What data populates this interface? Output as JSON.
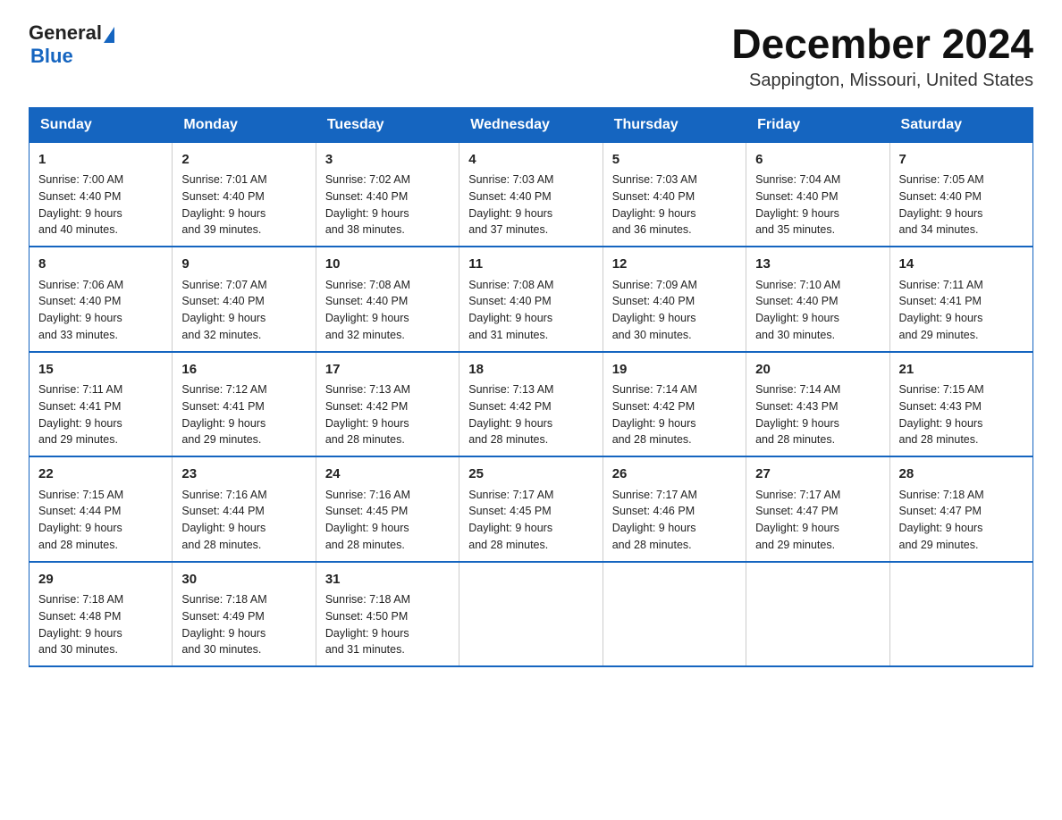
{
  "header": {
    "logo_general": "General",
    "logo_blue": "Blue",
    "month_title": "December 2024",
    "location": "Sappington, Missouri, United States"
  },
  "days_of_week": [
    "Sunday",
    "Monday",
    "Tuesday",
    "Wednesday",
    "Thursday",
    "Friday",
    "Saturday"
  ],
  "weeks": [
    [
      {
        "day": "1",
        "sunrise": "Sunrise: 7:00 AM",
        "sunset": "Sunset: 4:40 PM",
        "daylight": "Daylight: 9 hours",
        "minutes": "and 40 minutes."
      },
      {
        "day": "2",
        "sunrise": "Sunrise: 7:01 AM",
        "sunset": "Sunset: 4:40 PM",
        "daylight": "Daylight: 9 hours",
        "minutes": "and 39 minutes."
      },
      {
        "day": "3",
        "sunrise": "Sunrise: 7:02 AM",
        "sunset": "Sunset: 4:40 PM",
        "daylight": "Daylight: 9 hours",
        "minutes": "and 38 minutes."
      },
      {
        "day": "4",
        "sunrise": "Sunrise: 7:03 AM",
        "sunset": "Sunset: 4:40 PM",
        "daylight": "Daylight: 9 hours",
        "minutes": "and 37 minutes."
      },
      {
        "day": "5",
        "sunrise": "Sunrise: 7:03 AM",
        "sunset": "Sunset: 4:40 PM",
        "daylight": "Daylight: 9 hours",
        "minutes": "and 36 minutes."
      },
      {
        "day": "6",
        "sunrise": "Sunrise: 7:04 AM",
        "sunset": "Sunset: 4:40 PM",
        "daylight": "Daylight: 9 hours",
        "minutes": "and 35 minutes."
      },
      {
        "day": "7",
        "sunrise": "Sunrise: 7:05 AM",
        "sunset": "Sunset: 4:40 PM",
        "daylight": "Daylight: 9 hours",
        "minutes": "and 34 minutes."
      }
    ],
    [
      {
        "day": "8",
        "sunrise": "Sunrise: 7:06 AM",
        "sunset": "Sunset: 4:40 PM",
        "daylight": "Daylight: 9 hours",
        "minutes": "and 33 minutes."
      },
      {
        "day": "9",
        "sunrise": "Sunrise: 7:07 AM",
        "sunset": "Sunset: 4:40 PM",
        "daylight": "Daylight: 9 hours",
        "minutes": "and 32 minutes."
      },
      {
        "day": "10",
        "sunrise": "Sunrise: 7:08 AM",
        "sunset": "Sunset: 4:40 PM",
        "daylight": "Daylight: 9 hours",
        "minutes": "and 32 minutes."
      },
      {
        "day": "11",
        "sunrise": "Sunrise: 7:08 AM",
        "sunset": "Sunset: 4:40 PM",
        "daylight": "Daylight: 9 hours",
        "minutes": "and 31 minutes."
      },
      {
        "day": "12",
        "sunrise": "Sunrise: 7:09 AM",
        "sunset": "Sunset: 4:40 PM",
        "daylight": "Daylight: 9 hours",
        "minutes": "and 30 minutes."
      },
      {
        "day": "13",
        "sunrise": "Sunrise: 7:10 AM",
        "sunset": "Sunset: 4:40 PM",
        "daylight": "Daylight: 9 hours",
        "minutes": "and 30 minutes."
      },
      {
        "day": "14",
        "sunrise": "Sunrise: 7:11 AM",
        "sunset": "Sunset: 4:41 PM",
        "daylight": "Daylight: 9 hours",
        "minutes": "and 29 minutes."
      }
    ],
    [
      {
        "day": "15",
        "sunrise": "Sunrise: 7:11 AM",
        "sunset": "Sunset: 4:41 PM",
        "daylight": "Daylight: 9 hours",
        "minutes": "and 29 minutes."
      },
      {
        "day": "16",
        "sunrise": "Sunrise: 7:12 AM",
        "sunset": "Sunset: 4:41 PM",
        "daylight": "Daylight: 9 hours",
        "minutes": "and 29 minutes."
      },
      {
        "day": "17",
        "sunrise": "Sunrise: 7:13 AM",
        "sunset": "Sunset: 4:42 PM",
        "daylight": "Daylight: 9 hours",
        "minutes": "and 28 minutes."
      },
      {
        "day": "18",
        "sunrise": "Sunrise: 7:13 AM",
        "sunset": "Sunset: 4:42 PM",
        "daylight": "Daylight: 9 hours",
        "minutes": "and 28 minutes."
      },
      {
        "day": "19",
        "sunrise": "Sunrise: 7:14 AM",
        "sunset": "Sunset: 4:42 PM",
        "daylight": "Daylight: 9 hours",
        "minutes": "and 28 minutes."
      },
      {
        "day": "20",
        "sunrise": "Sunrise: 7:14 AM",
        "sunset": "Sunset: 4:43 PM",
        "daylight": "Daylight: 9 hours",
        "minutes": "and 28 minutes."
      },
      {
        "day": "21",
        "sunrise": "Sunrise: 7:15 AM",
        "sunset": "Sunset: 4:43 PM",
        "daylight": "Daylight: 9 hours",
        "minutes": "and 28 minutes."
      }
    ],
    [
      {
        "day": "22",
        "sunrise": "Sunrise: 7:15 AM",
        "sunset": "Sunset: 4:44 PM",
        "daylight": "Daylight: 9 hours",
        "minutes": "and 28 minutes."
      },
      {
        "day": "23",
        "sunrise": "Sunrise: 7:16 AM",
        "sunset": "Sunset: 4:44 PM",
        "daylight": "Daylight: 9 hours",
        "minutes": "and 28 minutes."
      },
      {
        "day": "24",
        "sunrise": "Sunrise: 7:16 AM",
        "sunset": "Sunset: 4:45 PM",
        "daylight": "Daylight: 9 hours",
        "minutes": "and 28 minutes."
      },
      {
        "day": "25",
        "sunrise": "Sunrise: 7:17 AM",
        "sunset": "Sunset: 4:45 PM",
        "daylight": "Daylight: 9 hours",
        "minutes": "and 28 minutes."
      },
      {
        "day": "26",
        "sunrise": "Sunrise: 7:17 AM",
        "sunset": "Sunset: 4:46 PM",
        "daylight": "Daylight: 9 hours",
        "minutes": "and 28 minutes."
      },
      {
        "day": "27",
        "sunrise": "Sunrise: 7:17 AM",
        "sunset": "Sunset: 4:47 PM",
        "daylight": "Daylight: 9 hours",
        "minutes": "and 29 minutes."
      },
      {
        "day": "28",
        "sunrise": "Sunrise: 7:18 AM",
        "sunset": "Sunset: 4:47 PM",
        "daylight": "Daylight: 9 hours",
        "minutes": "and 29 minutes."
      }
    ],
    [
      {
        "day": "29",
        "sunrise": "Sunrise: 7:18 AM",
        "sunset": "Sunset: 4:48 PM",
        "daylight": "Daylight: 9 hours",
        "minutes": "and 30 minutes."
      },
      {
        "day": "30",
        "sunrise": "Sunrise: 7:18 AM",
        "sunset": "Sunset: 4:49 PM",
        "daylight": "Daylight: 9 hours",
        "minutes": "and 30 minutes."
      },
      {
        "day": "31",
        "sunrise": "Sunrise: 7:18 AM",
        "sunset": "Sunset: 4:50 PM",
        "daylight": "Daylight: 9 hours",
        "minutes": "and 31 minutes."
      },
      null,
      null,
      null,
      null
    ]
  ]
}
